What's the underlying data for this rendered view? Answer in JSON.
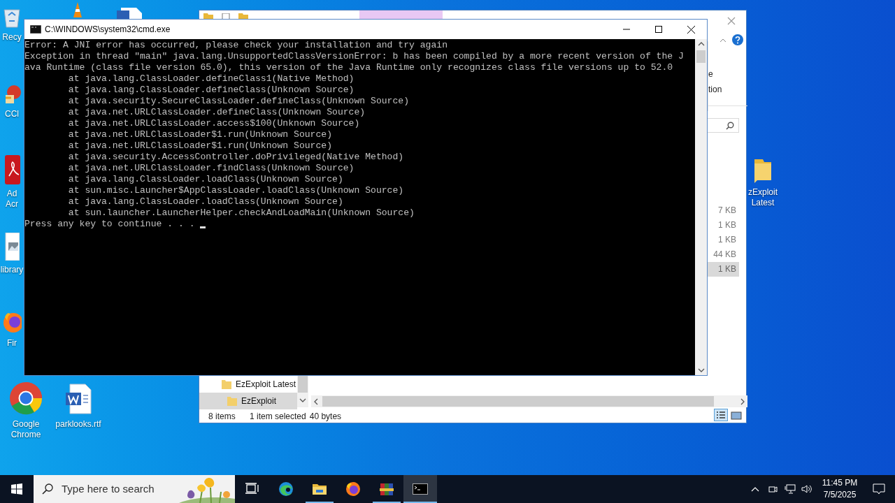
{
  "desktop_icons": [
    {
      "kind": "recycle-bin",
      "label": "Recy"
    },
    {
      "kind": "vlc"
    },
    {
      "kind": "word-doc"
    },
    {
      "kind": "ccleaner",
      "label": "CCl"
    },
    {
      "kind": "acrobat",
      "label": "Ad Acr"
    },
    {
      "kind": "image-file",
      "label": "library"
    },
    {
      "kind": "firefox",
      "label": "Fir"
    },
    {
      "kind": "chrome",
      "label": "Google Chrome"
    },
    {
      "kind": "word-doc",
      "label": "parklooks.rtf"
    },
    {
      "kind": "folder",
      "label": "zExploit Latest"
    }
  ],
  "explorer": {
    "ribbon_fragments": [
      "e",
      "tion"
    ],
    "file_sizes": [
      {
        "text": "7 KB",
        "selected": false
      },
      {
        "text": "1 KB",
        "selected": false
      },
      {
        "text": "1 KB",
        "selected": false
      },
      {
        "text": "44 KB",
        "selected": false
      },
      {
        "text": "1 KB",
        "selected": true
      }
    ],
    "nav_items": [
      {
        "label": "EzExploit Latest",
        "selected": false,
        "children": [
          {
            "label": "EzExploit",
            "selected": true
          }
        ]
      }
    ],
    "status": {
      "item_count": "8 items",
      "selection": "1 item selected",
      "size": "40 bytes"
    },
    "views": [
      {
        "kind": "details",
        "selected": true
      },
      {
        "kind": "large-icons",
        "selected": false
      }
    ]
  },
  "console": {
    "title": "C:\\WINDOWS\\system32\\cmd.exe",
    "lines": [
      {
        "kind": "plain",
        "text": "Error: A JNI error has occurred, please check your installation and try again"
      },
      {
        "kind": "plain",
        "text": "Exception in thread \"main\" java.lang.UnsupportedClassVersionError: b has been compiled by a more recent version of the Java Runtime (class file version 65.0), this version of the Java Runtime only recognizes class file versions up to 52.0"
      },
      {
        "kind": "trace",
        "text": "at java.lang.ClassLoader.defineClass1(Native Method)"
      },
      {
        "kind": "trace",
        "text": "at java.lang.ClassLoader.defineClass(Unknown Source)"
      },
      {
        "kind": "trace",
        "text": "at java.security.SecureClassLoader.defineClass(Unknown Source)"
      },
      {
        "kind": "trace",
        "text": "at java.net.URLClassLoader.defineClass(Unknown Source)"
      },
      {
        "kind": "trace",
        "text": "at java.net.URLClassLoader.access$100(Unknown Source)"
      },
      {
        "kind": "trace",
        "text": "at java.net.URLClassLoader$1.run(Unknown Source)"
      },
      {
        "kind": "trace",
        "text": "at java.net.URLClassLoader$1.run(Unknown Source)"
      },
      {
        "kind": "trace",
        "text": "at java.security.AccessController.doPrivileged(Native Method)"
      },
      {
        "kind": "trace",
        "text": "at java.net.URLClassLoader.findClass(Unknown Source)"
      },
      {
        "kind": "trace",
        "text": "at java.lang.ClassLoader.loadClass(Unknown Source)"
      },
      {
        "kind": "trace",
        "text": "at sun.misc.Launcher$AppClassLoader.loadClass(Unknown Source)"
      },
      {
        "kind": "trace",
        "text": "at java.lang.ClassLoader.loadClass(Unknown Source)"
      },
      {
        "kind": "trace",
        "text": "at sun.launcher.LauncherHelper.checkAndLoadMain(Unknown Source)"
      },
      {
        "kind": "prompt",
        "text": "Press any key to continue . . ."
      }
    ]
  },
  "taskbar": {
    "search_placeholder": "Type here to search",
    "apps": [
      {
        "kind": "task-view",
        "running": false,
        "selected": false
      },
      {
        "kind": "edge",
        "running": false,
        "selected": false
      },
      {
        "kind": "explorer",
        "running": true,
        "selected": false
      },
      {
        "kind": "firefox",
        "running": false,
        "selected": false
      },
      {
        "kind": "winrar",
        "running": true,
        "selected": false
      },
      {
        "kind": "console",
        "running": true,
        "selected": true
      }
    ],
    "clock": {
      "time": "11:45 PM",
      "date": "7/5/2025"
    }
  }
}
